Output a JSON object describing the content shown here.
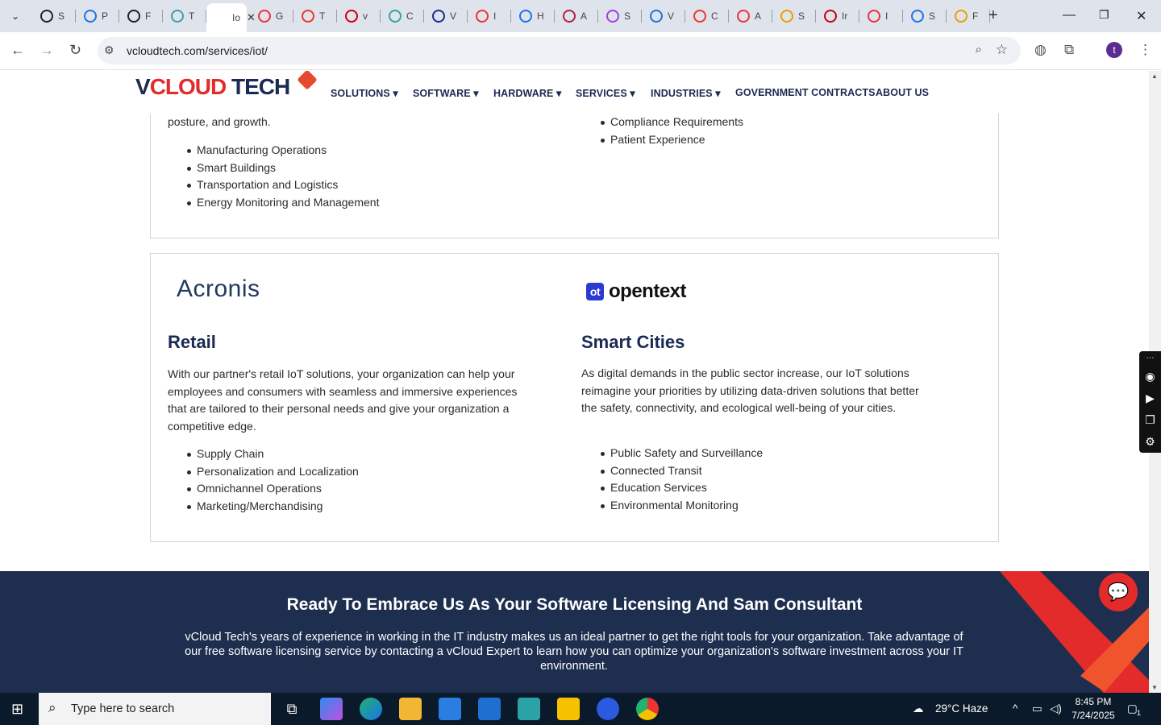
{
  "browser": {
    "tabs": [
      {
        "label": "S",
        "color": "#222"
      },
      {
        "label": "P",
        "color": "#1a73e8"
      },
      {
        "label": "F",
        "color": "#222"
      },
      {
        "label": "T",
        "color": "#3aa0a8"
      },
      {
        "label": "Io",
        "color": "#fff",
        "active": true
      },
      {
        "label": "G",
        "color": "#e33"
      },
      {
        "label": "T",
        "color": "#e33"
      },
      {
        "label": "v",
        "color": "#c00"
      },
      {
        "label": "C",
        "color": "#3aa0a8"
      },
      {
        "label": "V",
        "color": "#1a2a8a"
      },
      {
        "label": "I",
        "color": "#e33"
      },
      {
        "label": "H",
        "color": "#1a73e8"
      },
      {
        "label": "A",
        "color": "#b0204a"
      },
      {
        "label": "S",
        "color": "#a040e0"
      },
      {
        "label": "V",
        "color": "#1a73e8"
      },
      {
        "label": "C",
        "color": "#e33"
      },
      {
        "label": "A",
        "color": "#e33"
      },
      {
        "label": "S",
        "color": "#e8a000"
      },
      {
        "label": "Ir",
        "color": "#c00"
      },
      {
        "label": "I",
        "color": "#e33"
      },
      {
        "label": "S",
        "color": "#1a73e8"
      },
      {
        "label": "F",
        "color": "#e8a000"
      }
    ],
    "url": "vcloudtech.com/services/iot/",
    "profile_initial": "t"
  },
  "site": {
    "logo_text": "VCLOUD TECH",
    "logo_v": "V",
    "logo_cloud": "CLOUD",
    "logo_tech": " TECH",
    "menu": [
      "SOLUTIONS",
      "SOFTWARE",
      "HARDWARE",
      "SERVICES",
      "INDUSTRIES",
      "GOVERNMENT CONTRACTS",
      "ABOUT US"
    ],
    "dropdown_marker": "▾"
  },
  "card_top": {
    "left_tail_text": "posture, and growth.",
    "left_list": [
      "Manufacturing Operations",
      "Smart Buildings",
      "Transportation and Logistics",
      "Energy Monitoring and Management"
    ],
    "right_list": [
      "Compliance Requirements",
      "Patient Experience"
    ]
  },
  "card_bottom": {
    "left": {
      "logo": "Acronis",
      "title": "Retail",
      "body": "With our partner's retail IoT solutions, your organization can help your employees and consumers with seamless and immersive experiences that are tailored to their personal needs and give your organization a competitive edge.",
      "list": [
        "Supply Chain",
        "Personalization and Localization",
        "Omnichannel Operations",
        "Marketing/Merchandising"
      ]
    },
    "right": {
      "logo": "opentext",
      "logo_mark": "ot",
      "title": "Smart Cities",
      "body": "As digital demands in the public sector increase, our IoT solutions reimagine your priorities by utilizing data-driven solutions that better the safety, connectivity, and ecological well-being of your cities.",
      "list": [
        "Public Safety and Surveillance",
        "Connected Transit",
        "Education Services",
        "Environmental Monitoring"
      ]
    }
  },
  "cta": {
    "title": "Ready To Embrace Us As Your Software Licensing And Sam Consultant",
    "body": "vCloud Tech's years of experience in working in the IT industry makes us an ideal partner to get the right tools for your organization. Take advantage of our free software licensing service by contacting a vCloud Expert to learn how you can optimize your organization's software investment across your IT environment."
  },
  "taskbar": {
    "search_placeholder": "Type here to search",
    "weather": "29°C  Haze",
    "time": "8:45 PM",
    "date": "7/24/2025",
    "notifications": "1"
  },
  "colors": {
    "brand_navy": "#1b2a52",
    "brand_red": "#e32b2b",
    "cta_bg": "#1e2e4f"
  }
}
